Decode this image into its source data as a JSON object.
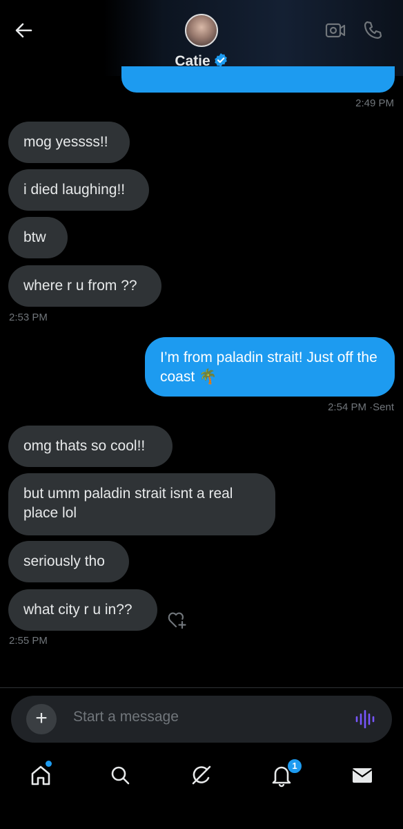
{
  "header": {
    "contact_name": "Catie",
    "verified": true,
    "accent_color": "#1d9bf0"
  },
  "messages": [
    {
      "dir": "in",
      "text": "mog yessss!!"
    },
    {
      "dir": "in",
      "text": "i died laughing!!"
    },
    {
      "dir": "in",
      "text": "btw"
    },
    {
      "dir": "in",
      "text": "where r u from ??"
    },
    {
      "dir": "out",
      "text": "I’m from paladin strait! Just off the coast 🌴"
    },
    {
      "dir": "in",
      "text": "omg thats so cool!!"
    },
    {
      "dir": "in",
      "text": "but umm paladin strait isnt a real place lol"
    },
    {
      "dir": "in",
      "text": "seriously tho"
    },
    {
      "dir": "in",
      "text": "what city r u in??"
    }
  ],
  "timestamps": {
    "top": "2:49 PM",
    "after_where_from": "2:53 PM",
    "after_sent": "2:54 PM",
    "sent_status": "Sent",
    "separator": "·",
    "last": "2:55 PM"
  },
  "composer": {
    "placeholder": "Start a message",
    "add_label": "+"
  },
  "nav": {
    "notifications_count": "1",
    "items": [
      "home-icon",
      "search-icon",
      "grok-icon",
      "bell-icon",
      "mail-icon"
    ]
  }
}
